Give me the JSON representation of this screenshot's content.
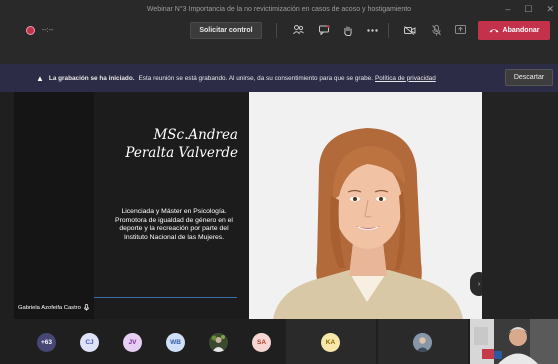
{
  "window": {
    "title": "Webinar N°3 Importancia de la no revictimización en casos de acoso y hostigamiento",
    "controls": [
      "–",
      "☐",
      "✕"
    ]
  },
  "toolbar": {
    "timer": "--:--",
    "request_control_label": "Solicitar control",
    "leave_label": "Abandonar",
    "icons": [
      "people-icon",
      "chat-icon",
      "raise-hand-icon",
      "more-icon",
      "camera-off-icon",
      "mic-off-icon",
      "share-icon"
    ],
    "leave_color": "#c4314b"
  },
  "banner": {
    "bold_text": "La grabación se ha iniciado.",
    "text": "Esta reunión se está grabando. Al unirse, da su consentimiento para que se grabe.",
    "link": "Política de privacidad",
    "dismiss_label": "Descartar",
    "background": "#2d2c46"
  },
  "stage": {
    "speaker_name_line1": "MSc.Andrea",
    "speaker_name_line2": "Peralta Valverde",
    "description": "Licenciada y Máster en Psicología. Promotora de igualdad de género en el deporte y la recreación por parte del Instituto Nacional de las Mujeres.",
    "presenter_tag": "Gabriela Azofeifa Castro"
  },
  "participants": {
    "overflow_count": "+63",
    "avatars": [
      {
        "initials": "CJ",
        "bg": "#dfe3f7",
        "fg": "#4b53bc"
      },
      {
        "initials": "JV",
        "bg": "#e6cff2",
        "fg": "#7b2e9e"
      },
      {
        "initials": "WB",
        "bg": "#cfe0f7",
        "fg": "#3661a8"
      },
      {
        "initials": "SA",
        "bg": "#f6d6d2",
        "fg": "#b43d2f"
      },
      {
        "initials": "KA",
        "bg": "#f7e7a8",
        "fg": "#8a6d00"
      }
    ]
  }
}
